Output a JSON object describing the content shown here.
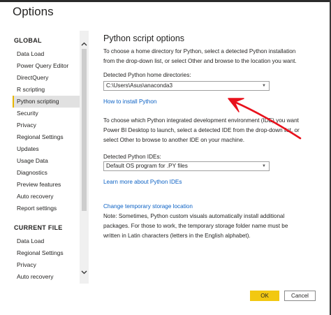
{
  "window": {
    "title": "Options"
  },
  "sidebar": {
    "global_header": "GLOBAL",
    "global_items": [
      "Data Load",
      "Power Query Editor",
      "DirectQuery",
      "R scripting",
      "Python scripting",
      "Security",
      "Privacy",
      "Regional Settings",
      "Updates",
      "Usage Data",
      "Diagnostics",
      "Preview features",
      "Auto recovery",
      "Report settings"
    ],
    "selected_item": "Python scripting",
    "current_file_header": "CURRENT FILE",
    "current_file_items": [
      "Data Load",
      "Regional Settings",
      "Privacy",
      "Auto recovery"
    ]
  },
  "main": {
    "title": "Python script options",
    "intro_lines": [
      "To choose a home directory for Python, select a detected Python installation",
      "from the drop-down list, or select Other and browse to the location you want."
    ],
    "home_label": "Detected Python home directories:",
    "home_value": "C:\\Users\\Asus\\anaconda3",
    "install_link": "How to install Python",
    "ide_lines": [
      "To choose which Python integrated development environment (IDE) you want",
      "Power BI Desktop to launch, select a detected IDE from the drop-down list, or",
      "select Other to browse to another IDE on your machine."
    ],
    "ide_label": "Detected Python IDEs:",
    "ide_value": "Default OS program for .PY files",
    "ide_link": "Learn more about Python IDEs",
    "storage_link": "Change temporary storage location",
    "note_lines": [
      "Note: Sometimes, Python custom visuals automatically install additional",
      "packages. For those to work, the temporary storage folder name must be",
      "written in Latin characters (letters in the English alphabet)."
    ]
  },
  "buttons": {
    "ok": "OK",
    "cancel": "Cancel"
  },
  "icons": {
    "scroll_up": "chevron-up-icon",
    "scroll_down": "chevron-down-icon",
    "dropdown": "caret-down-icon",
    "annotation": "red-arrow-icon"
  },
  "colors": {
    "accent": "#F2C811",
    "link": "#0B61C4",
    "annotation": "#E8111C",
    "selected_bg": "#E1E1E1"
  }
}
